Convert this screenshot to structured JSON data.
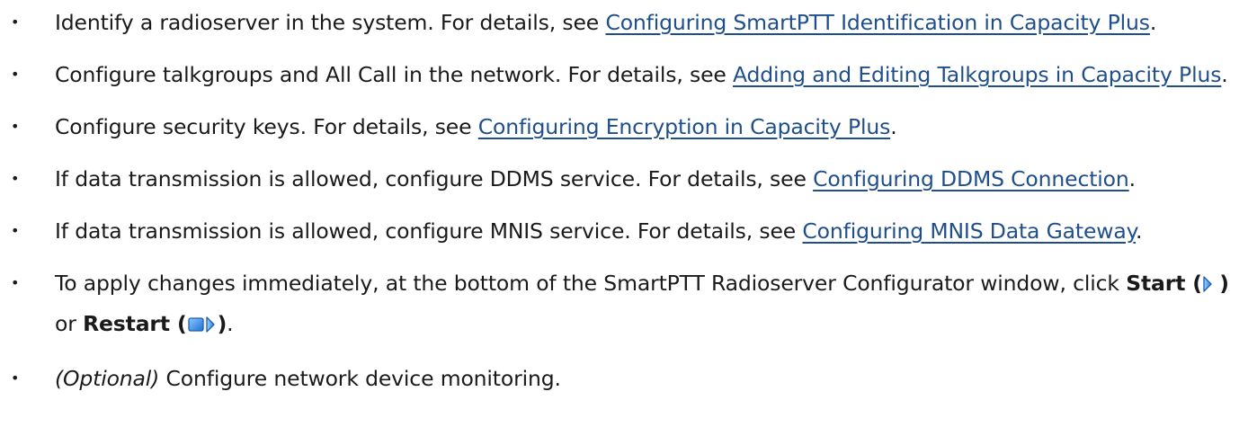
{
  "bullet_char": "•",
  "items": [
    {
      "text": "Identify a radioserver in the system. For details, see ",
      "link": "Configuring SmartPTT Identification in Capacity Plus",
      "end": "."
    },
    {
      "text": "Configure talkgroups and All Call in the network. For details, see ",
      "link": "Adding and Editing Talkgroups in Capacity Plus",
      "end": "."
    },
    {
      "text": "Configure security keys. For details, see ",
      "link": "Configuring Encryption in Capacity Plus",
      "end": "."
    },
    {
      "text": "If data transmission is allowed, configure DDMS service. For details, see ",
      "link": "Configuring DDMS Connection",
      "end": "."
    },
    {
      "text": "If data transmission is allowed, configure MNIS service. For details, see ",
      "link": "Configuring MNIS Data Gateway",
      "end": "."
    },
    {
      "text": "To apply changes immediately, at the bottom of the SmartPTT Radioserver Configurator window, click ",
      "start_label": "Start (",
      "start_close": ")",
      "or_text": " or ",
      "restart_label": "Restart (",
      "restart_close": ")",
      "end": ".",
      "start_icon": "play-triangle-icon",
      "restart_icon": "restart-square-play-icon"
    },
    {
      "optional_label": "(Optional)",
      "text": " Configure network device monitoring."
    }
  ]
}
